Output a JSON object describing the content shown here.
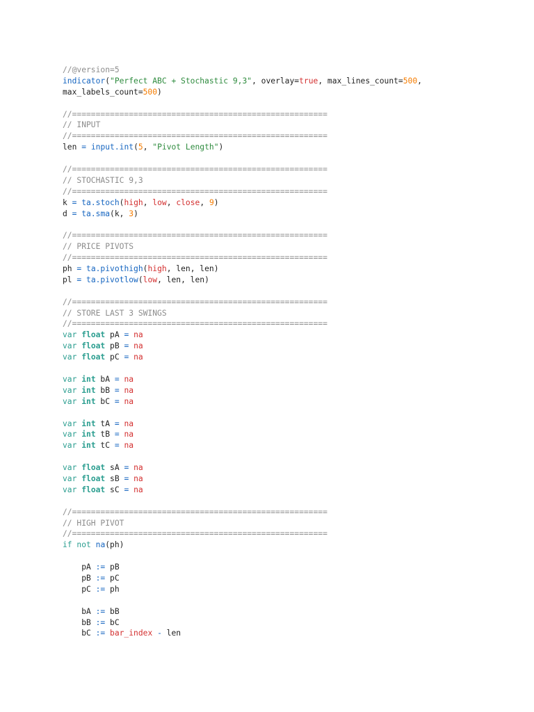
{
  "code": {
    "lines": [
      [
        [
          "cmt",
          "//@version=5"
        ]
      ],
      [
        [
          "fn",
          "indicator"
        ],
        [
          "pl",
          "("
        ],
        [
          "str",
          "\"Perfect ABC + Stochastic 9,3\""
        ],
        [
          "pl",
          ", overlay="
        ],
        [
          "bi",
          "true"
        ],
        [
          "pl",
          ", max_lines_count="
        ],
        [
          "num",
          "500"
        ],
        [
          "pl",
          ","
        ]
      ],
      [
        [
          "pl",
          "max_labels_count="
        ],
        [
          "num",
          "500"
        ],
        [
          "pl",
          ")"
        ]
      ],
      [],
      [
        [
          "cmt",
          "//======================================================"
        ]
      ],
      [
        [
          "cmt",
          "// INPUT"
        ]
      ],
      [
        [
          "cmt",
          "//======================================================"
        ]
      ],
      [
        [
          "pl",
          "len "
        ],
        [
          "op",
          "="
        ],
        [
          "pl",
          " "
        ],
        [
          "fn",
          "input.int"
        ],
        [
          "pl",
          "("
        ],
        [
          "num",
          "5"
        ],
        [
          "pl",
          ", "
        ],
        [
          "str",
          "\"Pivot Length\""
        ],
        [
          "pl",
          ")"
        ]
      ],
      [],
      [
        [
          "cmt",
          "//======================================================"
        ]
      ],
      [
        [
          "cmt",
          "// STOCHASTIC 9,3"
        ]
      ],
      [
        [
          "cmt",
          "//======================================================"
        ]
      ],
      [
        [
          "pl",
          "k "
        ],
        [
          "op",
          "="
        ],
        [
          "pl",
          " "
        ],
        [
          "fn",
          "ta.stoch"
        ],
        [
          "pl",
          "("
        ],
        [
          "bi",
          "high"
        ],
        [
          "pl",
          ", "
        ],
        [
          "bi",
          "low"
        ],
        [
          "pl",
          ", "
        ],
        [
          "bi",
          "close"
        ],
        [
          "pl",
          ", "
        ],
        [
          "num",
          "9"
        ],
        [
          "pl",
          ")"
        ]
      ],
      [
        [
          "pl",
          "d "
        ],
        [
          "op",
          "="
        ],
        [
          "pl",
          " "
        ],
        [
          "fn",
          "ta.sma"
        ],
        [
          "pl",
          "(k, "
        ],
        [
          "num",
          "3"
        ],
        [
          "pl",
          ")"
        ]
      ],
      [],
      [
        [
          "cmt",
          "//======================================================"
        ]
      ],
      [
        [
          "cmt",
          "// PRICE PIVOTS"
        ]
      ],
      [
        [
          "cmt",
          "//======================================================"
        ]
      ],
      [
        [
          "pl",
          "ph "
        ],
        [
          "op",
          "="
        ],
        [
          "pl",
          " "
        ],
        [
          "fn",
          "ta.pivothigh"
        ],
        [
          "pl",
          "("
        ],
        [
          "bi",
          "high"
        ],
        [
          "pl",
          ", len, len)"
        ]
      ],
      [
        [
          "pl",
          "pl "
        ],
        [
          "op",
          "="
        ],
        [
          "pl",
          " "
        ],
        [
          "fn",
          "ta.pivotlow"
        ],
        [
          "pl",
          "("
        ],
        [
          "bi",
          "low"
        ],
        [
          "pl",
          ", len, len)"
        ]
      ],
      [],
      [
        [
          "cmt",
          "//======================================================"
        ]
      ],
      [
        [
          "cmt",
          "// STORE LAST 3 SWINGS"
        ]
      ],
      [
        [
          "cmt",
          "//======================================================"
        ]
      ],
      [
        [
          "kw",
          "var"
        ],
        [
          "pl",
          " "
        ],
        [
          "kwb",
          "float"
        ],
        [
          "pl",
          " pA "
        ],
        [
          "op",
          "="
        ],
        [
          "pl",
          " "
        ],
        [
          "na",
          "na"
        ]
      ],
      [
        [
          "kw",
          "var"
        ],
        [
          "pl",
          " "
        ],
        [
          "kwb",
          "float"
        ],
        [
          "pl",
          " pB "
        ],
        [
          "op",
          "="
        ],
        [
          "pl",
          " "
        ],
        [
          "na",
          "na"
        ]
      ],
      [
        [
          "kw",
          "var"
        ],
        [
          "pl",
          " "
        ],
        [
          "kwb",
          "float"
        ],
        [
          "pl",
          " pC "
        ],
        [
          "op",
          "="
        ],
        [
          "pl",
          " "
        ],
        [
          "na",
          "na"
        ]
      ],
      [],
      [
        [
          "kw",
          "var"
        ],
        [
          "pl",
          " "
        ],
        [
          "kwb",
          "int"
        ],
        [
          "pl",
          " bA "
        ],
        [
          "op",
          "="
        ],
        [
          "pl",
          " "
        ],
        [
          "na",
          "na"
        ]
      ],
      [
        [
          "kw",
          "var"
        ],
        [
          "pl",
          " "
        ],
        [
          "kwb",
          "int"
        ],
        [
          "pl",
          " bB "
        ],
        [
          "op",
          "="
        ],
        [
          "pl",
          " "
        ],
        [
          "na",
          "na"
        ]
      ],
      [
        [
          "kw",
          "var"
        ],
        [
          "pl",
          " "
        ],
        [
          "kwb",
          "int"
        ],
        [
          "pl",
          " bC "
        ],
        [
          "op",
          "="
        ],
        [
          "pl",
          " "
        ],
        [
          "na",
          "na"
        ]
      ],
      [],
      [
        [
          "kw",
          "var"
        ],
        [
          "pl",
          " "
        ],
        [
          "kwb",
          "int"
        ],
        [
          "pl",
          " tA "
        ],
        [
          "op",
          "="
        ],
        [
          "pl",
          " "
        ],
        [
          "na",
          "na"
        ]
      ],
      [
        [
          "kw",
          "var"
        ],
        [
          "pl",
          " "
        ],
        [
          "kwb",
          "int"
        ],
        [
          "pl",
          " tB "
        ],
        [
          "op",
          "="
        ],
        [
          "pl",
          " "
        ],
        [
          "na",
          "na"
        ]
      ],
      [
        [
          "kw",
          "var"
        ],
        [
          "pl",
          " "
        ],
        [
          "kwb",
          "int"
        ],
        [
          "pl",
          " tC "
        ],
        [
          "op",
          "="
        ],
        [
          "pl",
          " "
        ],
        [
          "na",
          "na"
        ]
      ],
      [],
      [
        [
          "kw",
          "var"
        ],
        [
          "pl",
          " "
        ],
        [
          "kwb",
          "float"
        ],
        [
          "pl",
          " sA "
        ],
        [
          "op",
          "="
        ],
        [
          "pl",
          " "
        ],
        [
          "na",
          "na"
        ]
      ],
      [
        [
          "kw",
          "var"
        ],
        [
          "pl",
          " "
        ],
        [
          "kwb",
          "float"
        ],
        [
          "pl",
          " sB "
        ],
        [
          "op",
          "="
        ],
        [
          "pl",
          " "
        ],
        [
          "na",
          "na"
        ]
      ],
      [
        [
          "kw",
          "var"
        ],
        [
          "pl",
          " "
        ],
        [
          "kwb",
          "float"
        ],
        [
          "pl",
          " sC "
        ],
        [
          "op",
          "="
        ],
        [
          "pl",
          " "
        ],
        [
          "na",
          "na"
        ]
      ],
      [],
      [
        [
          "cmt",
          "//======================================================"
        ]
      ],
      [
        [
          "cmt",
          "// HIGH PIVOT"
        ]
      ],
      [
        [
          "cmt",
          "//======================================================"
        ]
      ],
      [
        [
          "kw",
          "if"
        ],
        [
          "pl",
          " "
        ],
        [
          "kw",
          "not"
        ],
        [
          "pl",
          " "
        ],
        [
          "fn",
          "na"
        ],
        [
          "pl",
          "(ph)"
        ]
      ],
      [],
      [
        [
          "pl",
          "    pA "
        ],
        [
          "op",
          ":="
        ],
        [
          "pl",
          " pB"
        ]
      ],
      [
        [
          "pl",
          "    pB "
        ],
        [
          "op",
          ":="
        ],
        [
          "pl",
          " pC"
        ]
      ],
      [
        [
          "pl",
          "    pC "
        ],
        [
          "op",
          ":="
        ],
        [
          "pl",
          " ph"
        ]
      ],
      [],
      [
        [
          "pl",
          "    bA "
        ],
        [
          "op",
          ":="
        ],
        [
          "pl",
          " bB"
        ]
      ],
      [
        [
          "pl",
          "    bB "
        ],
        [
          "op",
          ":="
        ],
        [
          "pl",
          " bC"
        ]
      ],
      [
        [
          "pl",
          "    bC "
        ],
        [
          "op",
          ":="
        ],
        [
          "pl",
          " "
        ],
        [
          "bi",
          "bar_index"
        ],
        [
          "pl",
          " "
        ],
        [
          "op",
          "-"
        ],
        [
          "pl",
          " len"
        ]
      ]
    ]
  }
}
